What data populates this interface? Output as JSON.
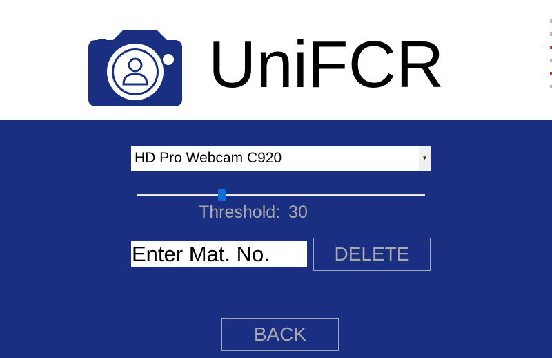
{
  "header": {
    "app_title": "UniFCR",
    "logo_icon": "camera-user-icon"
  },
  "colors": {
    "brand_blue": "#1b2f82",
    "button_text": "#a9a9ad",
    "slider_thumb": "#0a6fd8"
  },
  "camera": {
    "selected": "HD Pro Webcam C920",
    "dropdown_icon": "chevron-down-icon"
  },
  "threshold": {
    "label": "Threshold:",
    "value": "30",
    "slider_fraction": 0.297
  },
  "matric": {
    "placeholder": "Enter Mat. No."
  },
  "buttons": {
    "delete": "DELETE",
    "back": "BACK"
  }
}
